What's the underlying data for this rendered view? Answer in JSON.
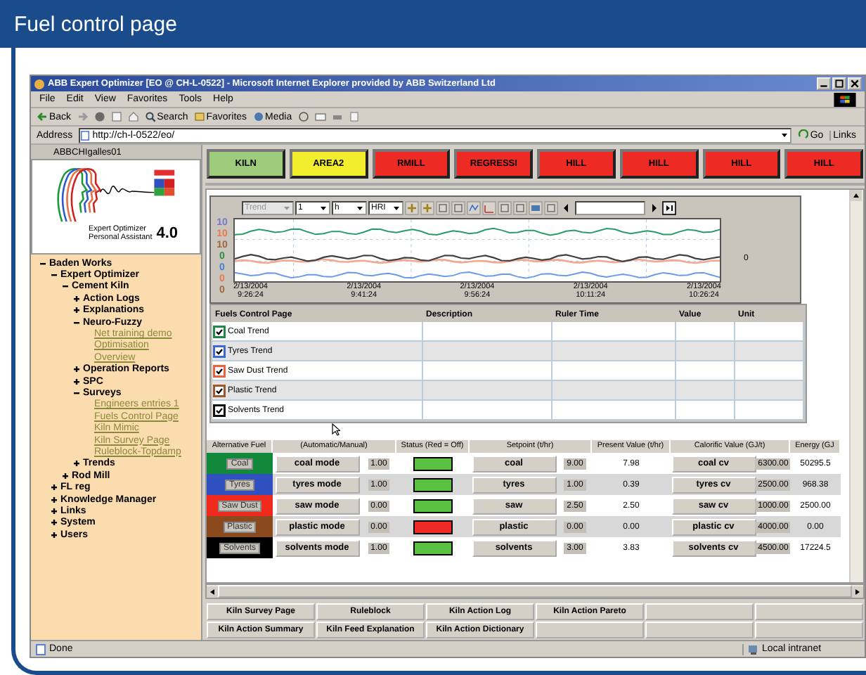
{
  "page_title": "Fuel control page",
  "browser": {
    "title": "ABB Expert Optimizer [EO @ CH-L-0522] - Microsoft Internet Explorer provided by ABB Switzerland Ltd",
    "menu": [
      "File",
      "Edit",
      "View",
      "Favorites",
      "Tools",
      "Help"
    ],
    "toolbar": [
      "Back",
      "Search",
      "Favorites",
      "Media"
    ],
    "address_label": "Address",
    "address": "http://ch-l-0522/eo/",
    "go": "Go",
    "links": "Links"
  },
  "sidebar": {
    "user": "ABBCHIgalles01",
    "logo": {
      "line1": "Expert Optimizer",
      "line2": "Personal Assistant",
      "version": "4.0"
    },
    "tree": [
      {
        "label": "Baden Works",
        "expanded": true,
        "children": [
          {
            "label": "Expert Optimizer",
            "expanded": true,
            "children": [
              {
                "label": "Cement Kiln",
                "expanded": true,
                "children": [
                  {
                    "label": "Action Logs",
                    "expanded": false
                  },
                  {
                    "label": "Explanations",
                    "expanded": false
                  },
                  {
                    "label": "Neuro-Fuzzy",
                    "expanded": true,
                    "children": [
                      {
                        "label": "Net training demo",
                        "kind": "link"
                      },
                      {
                        "label": "Optimisation",
                        "kind": "link"
                      },
                      {
                        "label": "Overview",
                        "kind": "link"
                      }
                    ]
                  },
                  {
                    "label": "Operation Reports",
                    "expanded": false
                  },
                  {
                    "label": "SPC",
                    "expanded": false
                  },
                  {
                    "label": "Surveys",
                    "expanded": true,
                    "children": [
                      {
                        "label": "Engineers entries 1",
                        "kind": "link"
                      },
                      {
                        "label": "Fuels Control Page",
                        "kind": "link"
                      },
                      {
                        "label": "Kiln Mimic",
                        "kind": "link"
                      },
                      {
                        "label": "Kiln Survey Page",
                        "kind": "link"
                      },
                      {
                        "label": "Ruleblock-Topdamp",
                        "kind": "link"
                      }
                    ]
                  },
                  {
                    "label": "Trends",
                    "expanded": false
                  }
                ]
              },
              {
                "label": "Rod Mill",
                "expanded": false
              }
            ]
          },
          {
            "label": "FL reg",
            "expanded": false
          },
          {
            "label": "Knowledge Manager",
            "expanded": false
          },
          {
            "label": "Links",
            "expanded": false
          },
          {
            "label": "System",
            "expanded": false
          },
          {
            "label": "Users",
            "expanded": false
          }
        ]
      }
    ]
  },
  "areas": [
    {
      "label": "KILN",
      "color": "#9ccc7c"
    },
    {
      "label": "AREA2",
      "color": "#f2ee2e"
    },
    {
      "label": "RMILL",
      "color": "#ee2a24"
    },
    {
      "label": "REGRESSI",
      "color": "#ee2a24"
    },
    {
      "label": "HILL",
      "color": "#ee2a24"
    },
    {
      "label": "HILL",
      "color": "#ee2a24"
    },
    {
      "label": "HILL",
      "color": "#ee2a24"
    },
    {
      "label": "HILL",
      "color": "#ee2a24"
    }
  ],
  "trend": {
    "controls": [
      {
        "label": "Trend",
        "disabled": true
      },
      {
        "label": "1",
        "disabled": false
      },
      {
        "label": "h",
        "disabled": false
      },
      {
        "label": "HRI",
        "disabled": false
      }
    ],
    "y_ticks": [
      {
        "label": "10",
        "color": "#7878c8"
      },
      {
        "label": "10",
        "color": "#e87850"
      },
      {
        "label": "10",
        "color": "#a0643c"
      },
      {
        "label": "0",
        "color": "#2e8b3e"
      },
      {
        "label": "0",
        "color": "#4a78d8"
      },
      {
        "label": "0",
        "color": "#e87850"
      },
      {
        "label": "0",
        "color": "#a0643c"
      }
    ],
    "x_labels": [
      {
        "date": "2/13/2004",
        "time": "9:26:24"
      },
      {
        "date": "2/13/2004",
        "time": "9:41:24"
      },
      {
        "date": "2/13/2004",
        "time": "9:56:24"
      },
      {
        "date": "2/13/2004",
        "time": "10:11:24"
      },
      {
        "date": "2/13/2004",
        "time": "10:26:24"
      }
    ],
    "right_tick": "0"
  },
  "trend_table": {
    "columns": [
      "Fuels Control Page",
      "Description",
      "Ruler Time",
      "Value",
      "Unit"
    ],
    "rows": [
      {
        "label": "Coal Trend",
        "checked": true,
        "color": "#1e8a4a"
      },
      {
        "label": "Tyres Trend",
        "checked": true,
        "color": "#3a6ad8"
      },
      {
        "label": "Saw Dust Trend",
        "checked": true,
        "color": "#f06040"
      },
      {
        "label": "Plastic Trend",
        "checked": true,
        "color": "#9a5a30"
      },
      {
        "label": "Solvents Trend",
        "checked": true,
        "color": "#101010"
      }
    ]
  },
  "fuel_grid": {
    "columns": [
      "Alternative Fuel",
      "(Automatic/Manual)",
      "Status (Red = Off)",
      "Setpoint (t/hr)",
      "Present Value (t/hr)",
      "Calorific Value (GJ/t)",
      "Energy (GJ"
    ],
    "rows": [
      {
        "fuel": "Coal",
        "color": "#12883a",
        "mode": "coal mode",
        "mode_value": "1.00",
        "status_on": true,
        "setpoint": "coal",
        "setpoint_value": "9.00",
        "present_value": "7.98",
        "cv": "coal cv",
        "cv_value": "6300.00",
        "energy": "50295.5"
      },
      {
        "fuel": "Tyres",
        "color": "#3050c0",
        "mode": "tyres mode",
        "mode_value": "1.00",
        "status_on": true,
        "setpoint": "tyres",
        "setpoint_value": "1.00",
        "present_value": "0.39",
        "cv": "tyres cv",
        "cv_value": "2500.00",
        "energy": "968.38"
      },
      {
        "fuel": "Saw Dust",
        "color": "#f02a1c",
        "mode": "saw mode",
        "mode_value": "0.00",
        "status_on": true,
        "setpoint": "saw",
        "setpoint_value": "2.50",
        "present_value": "2.50",
        "cv": "saw cv",
        "cv_value": "1000.00",
        "energy": "2500.00"
      },
      {
        "fuel": "Plastic",
        "color": "#8a4a1e",
        "mode": "plastic mode",
        "mode_value": "0.00",
        "status_on": false,
        "setpoint": "plastic",
        "setpoint_value": "0.00",
        "present_value": "0.00",
        "cv": "plastic cv",
        "cv_value": "4000.00",
        "energy": "0.00"
      },
      {
        "fuel": "Solvents",
        "color": "#000000",
        "mode": "solvents mode",
        "mode_value": "1.00",
        "status_on": true,
        "setpoint": "solvents",
        "setpoint_value": "3.00",
        "present_value": "3.83",
        "cv": "solvents cv",
        "cv_value": "4500.00",
        "energy": "17224.5"
      }
    ]
  },
  "nav_buttons": [
    {
      "kind": "label",
      "label": "Kiln Survey Page"
    },
    {
      "kind": "label",
      "label": "Ruleblock"
    },
    {
      "kind": "label",
      "label": "Kiln Action Log"
    },
    {
      "kind": "label",
      "label": "Kiln Action Pareto"
    },
    {
      "kind": "blank"
    },
    {
      "kind": "blank"
    },
    {
      "kind": "label",
      "label": "Kiln Action Summary"
    },
    {
      "kind": "label",
      "label": "Kiln Feed Explanation"
    },
    {
      "kind": "label",
      "label": "Kiln Action Dictionary"
    },
    {
      "kind": "blank"
    },
    {
      "kind": "blank"
    },
    {
      "kind": "blank"
    }
  ],
  "status_bar": {
    "text": "Done",
    "zone": "Local intranet"
  }
}
